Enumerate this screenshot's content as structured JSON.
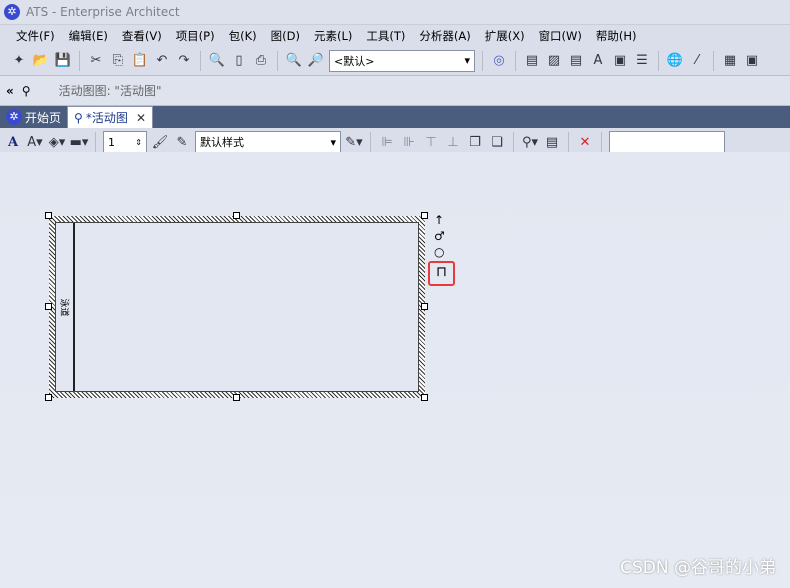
{
  "window": {
    "title": "ATS - Enterprise Architect"
  },
  "menu": [
    "文件(F)",
    "编辑(E)",
    "查看(V)",
    "项目(P)",
    "包(K)",
    "图(D)",
    "元素(L)",
    "工具(T)",
    "分析器(A)",
    "扩展(X)",
    "窗口(W)",
    "帮助(H)"
  ],
  "toolbar": {
    "perspective_combo": "<默认>"
  },
  "breadcrumb": {
    "text": "活动图图: \"活动图\""
  },
  "tabs": [
    {
      "label": "开始页"
    },
    {
      "label": "*活动图"
    }
  ],
  "format_toolbar": {
    "line_width": "1",
    "style_combo": "默认样式",
    "search_value": ""
  },
  "diagram": {
    "partition_label": "泳道"
  },
  "watermark": "CSDN @谷哥的小弟",
  "colors": {
    "tab_bar": "#4a5d7e",
    "highlight": "#e83a3a",
    "accent": "#3a4ad0"
  }
}
